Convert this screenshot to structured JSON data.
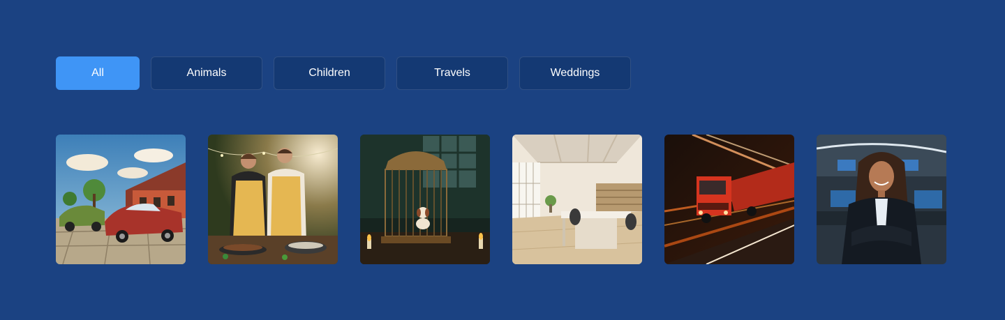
{
  "filters": {
    "items": [
      {
        "label": "All",
        "active": true
      },
      {
        "label": "Animals",
        "active": false
      },
      {
        "label": "Children",
        "active": false
      },
      {
        "label": "Travels",
        "active": false
      },
      {
        "label": "Weddings",
        "active": false
      }
    ],
    "colors": {
      "active_bg": "#3f95f6",
      "inactive_border": "rgba(255,255,255,0.12)",
      "text": "#ffffff"
    }
  },
  "page": {
    "background": "#1b4282"
  }
}
